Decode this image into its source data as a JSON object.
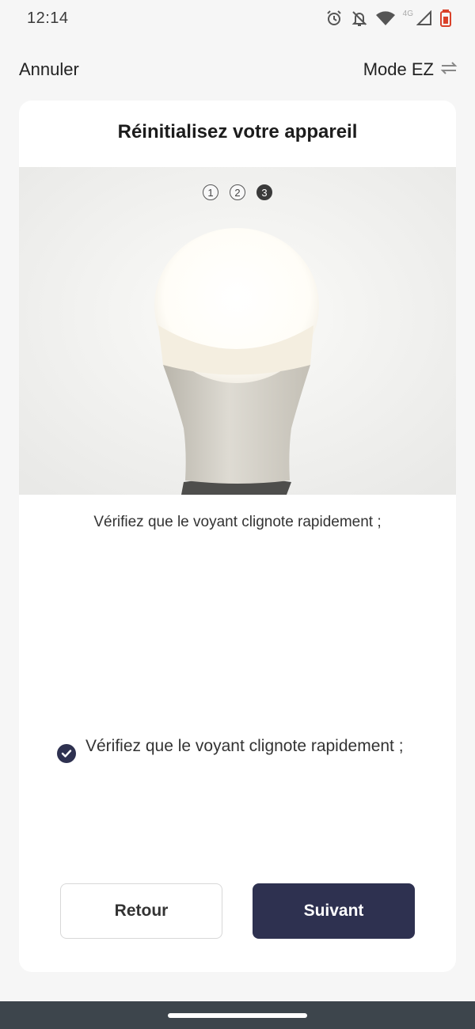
{
  "status_bar": {
    "time": "12:14",
    "network_label": "4G",
    "icons": [
      "alarm-icon",
      "notifications-off-icon",
      "wifi-icon",
      "cellular-signal-icon",
      "battery-low-icon"
    ]
  },
  "header": {
    "cancel_label": "Annuler",
    "mode_label": "Mode EZ",
    "mode_icon": "swap-arrows-icon"
  },
  "card": {
    "title": "Réinitialisez votre appareil",
    "steps": [
      "1",
      "2",
      "3"
    ],
    "active_step": 3,
    "illustration": "light-bulb-image",
    "instruction": "Vérifiez que le voyant clignote rapidement ;",
    "confirm_checkbox_label": "Vérifiez que le voyant clignote rapidement ;",
    "confirm_checked": true,
    "back_button_label": "Retour",
    "next_button_label": "Suivant"
  },
  "colors": {
    "primary": "#2e3150",
    "background": "#f6f6f6",
    "card": "#ffffff",
    "navbar": "#3d454c"
  }
}
